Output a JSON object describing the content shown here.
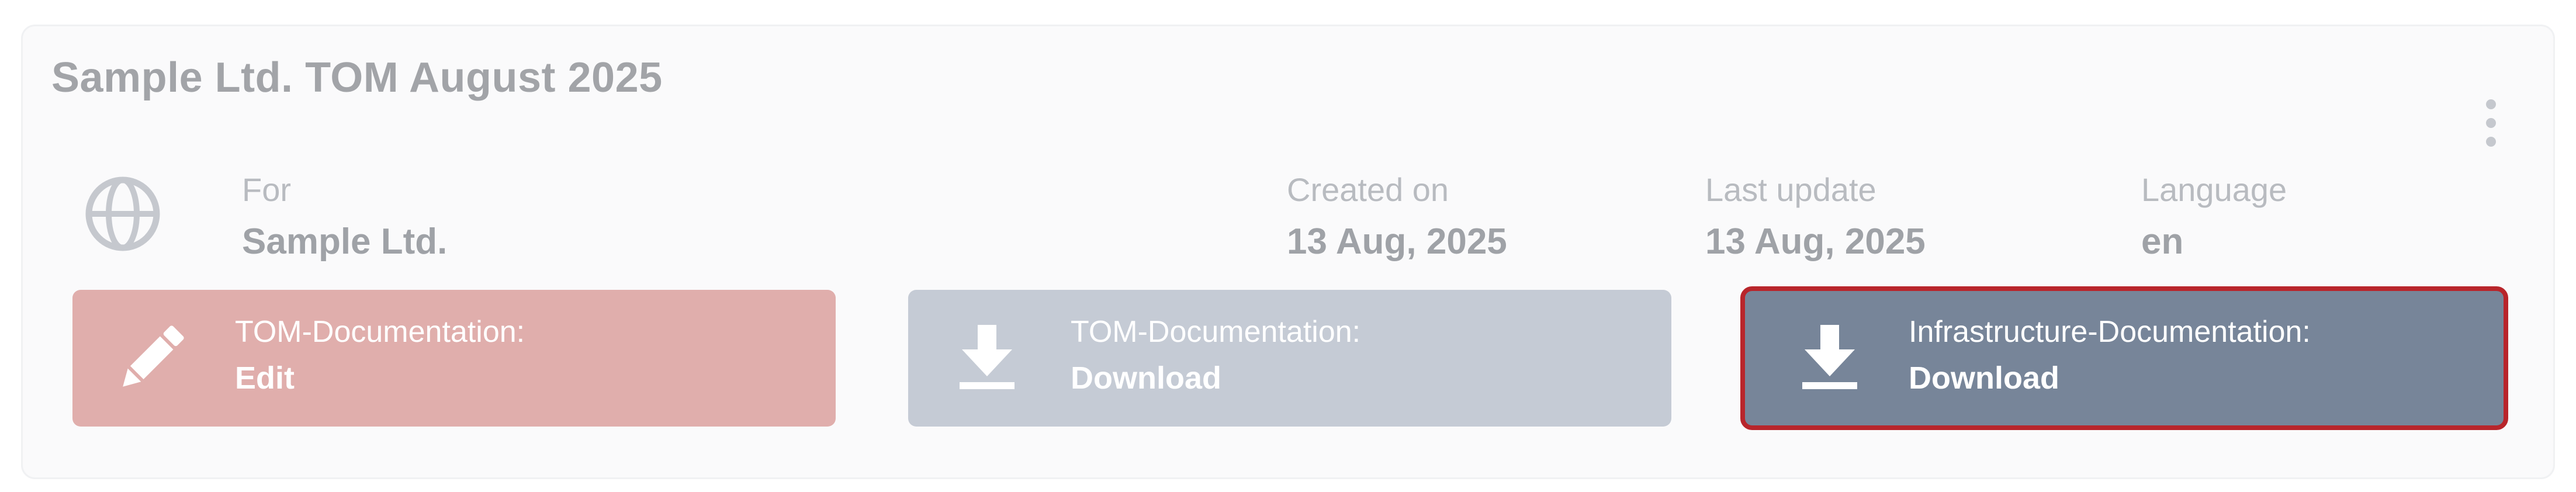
{
  "card": {
    "title": "Sample Ltd. TOM August 2025",
    "menu_icon": "more-vertical-icon",
    "entity_icon": "globe-icon"
  },
  "meta": {
    "for_label": "For",
    "for_value": "Sample Ltd.",
    "created_label": "Created on",
    "created_value": "13 Aug, 2025",
    "updated_label": "Last update",
    "updated_value": "13 Aug, 2025",
    "language_label": "Language",
    "language_value": "en"
  },
  "actions": [
    {
      "label": "TOM-Documentation:",
      "action": "Edit",
      "icon": "pencil-icon",
      "color": "#e0aeac"
    },
    {
      "label": "TOM-Documentation:",
      "action": "Download",
      "icon": "download-icon",
      "color": "#c5cbd5"
    },
    {
      "label": "Infrastructure-Documentation:",
      "action": "Download",
      "icon": "download-icon",
      "color": "#778599",
      "highlight_color": "#b8252b"
    }
  ]
}
